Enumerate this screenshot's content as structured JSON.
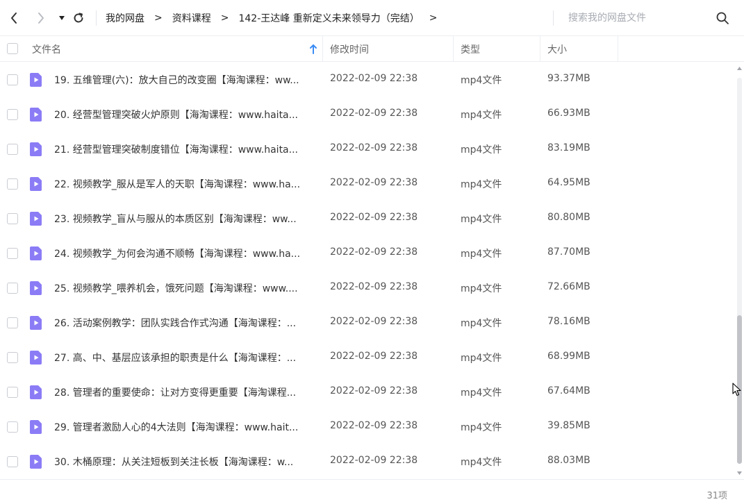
{
  "toolbar": {
    "breadcrumb": [
      "我的网盘",
      "资料课程",
      "142-王达峰 重新定义未来领导力（完结）"
    ],
    "separator": ">",
    "trailing_separator": ">",
    "search_placeholder": "搜索我的网盘文件"
  },
  "header": {
    "name": "文件名",
    "modified": "修改时间",
    "type": "类型",
    "size": "大小"
  },
  "files": [
    {
      "name": "19. 五维管理(六)：放大自己的改变圈【海淘课程：ww...",
      "time": "2022-02-09 22:38",
      "type": "mp4文件",
      "size": "93.37MB"
    },
    {
      "name": "20. 经营型管理突破火炉原则【海淘课程：www.haita...",
      "time": "2022-02-09 22:38",
      "type": "mp4文件",
      "size": "66.93MB"
    },
    {
      "name": "21. 经营型管理突破制度错位【海淘课程：www.haita...",
      "time": "2022-02-09 22:38",
      "type": "mp4文件",
      "size": "83.19MB"
    },
    {
      "name": "22. 视频教学_服从是军人的天职【海淘课程：www.ha...",
      "time": "2022-02-09 22:38",
      "type": "mp4文件",
      "size": "64.95MB"
    },
    {
      "name": "23. 视频教学_盲从与服从的本质区别【海淘课程：ww...",
      "time": "2022-02-09 22:38",
      "type": "mp4文件",
      "size": "80.80MB"
    },
    {
      "name": "24. 视频教学_为何会沟通不顺畅【海淘课程：www.ha...",
      "time": "2022-02-09 22:38",
      "type": "mp4文件",
      "size": "87.70MB"
    },
    {
      "name": "25. 视频教学_喂养机会，饿死问题【海淘课程：www....",
      "time": "2022-02-09 22:38",
      "type": "mp4文件",
      "size": "72.66MB"
    },
    {
      "name": "26. 活动案例教学：团队实践合作式沟通【海淘课程：...",
      "time": "2022-02-09 22:38",
      "type": "mp4文件",
      "size": "78.16MB"
    },
    {
      "name": "27. 高、中、基层应该承担的职责是什么【海淘课程：...",
      "time": "2022-02-09 22:38",
      "type": "mp4文件",
      "size": "68.99MB"
    },
    {
      "name": "28. 管理者的重要使命：让对方变得更重要【海淘课程...",
      "time": "2022-02-09 22:38",
      "type": "mp4文件",
      "size": "67.64MB"
    },
    {
      "name": "29. 管理者激励人心的4大法则【海淘课程：www.hait...",
      "time": "2022-02-09 22:38",
      "type": "mp4文件",
      "size": "39.85MB"
    },
    {
      "name": "30. 木桶原理：从关注短板到关注长板【海淘课程：w...",
      "time": "2022-02-09 22:38",
      "type": "mp4文件",
      "size": "88.03MB"
    }
  ],
  "footer": {
    "count": "31项"
  },
  "colors": {
    "file_icon": "#8b7cf6",
    "sort_arrow": "#3b8cf5"
  },
  "icons": {
    "back": "chevron-left-icon",
    "forward": "chevron-right-icon",
    "history": "caret-down-icon",
    "refresh": "refresh-icon",
    "search": "search-icon",
    "file": "video-file-icon",
    "sort": "sort-asc-icon"
  }
}
